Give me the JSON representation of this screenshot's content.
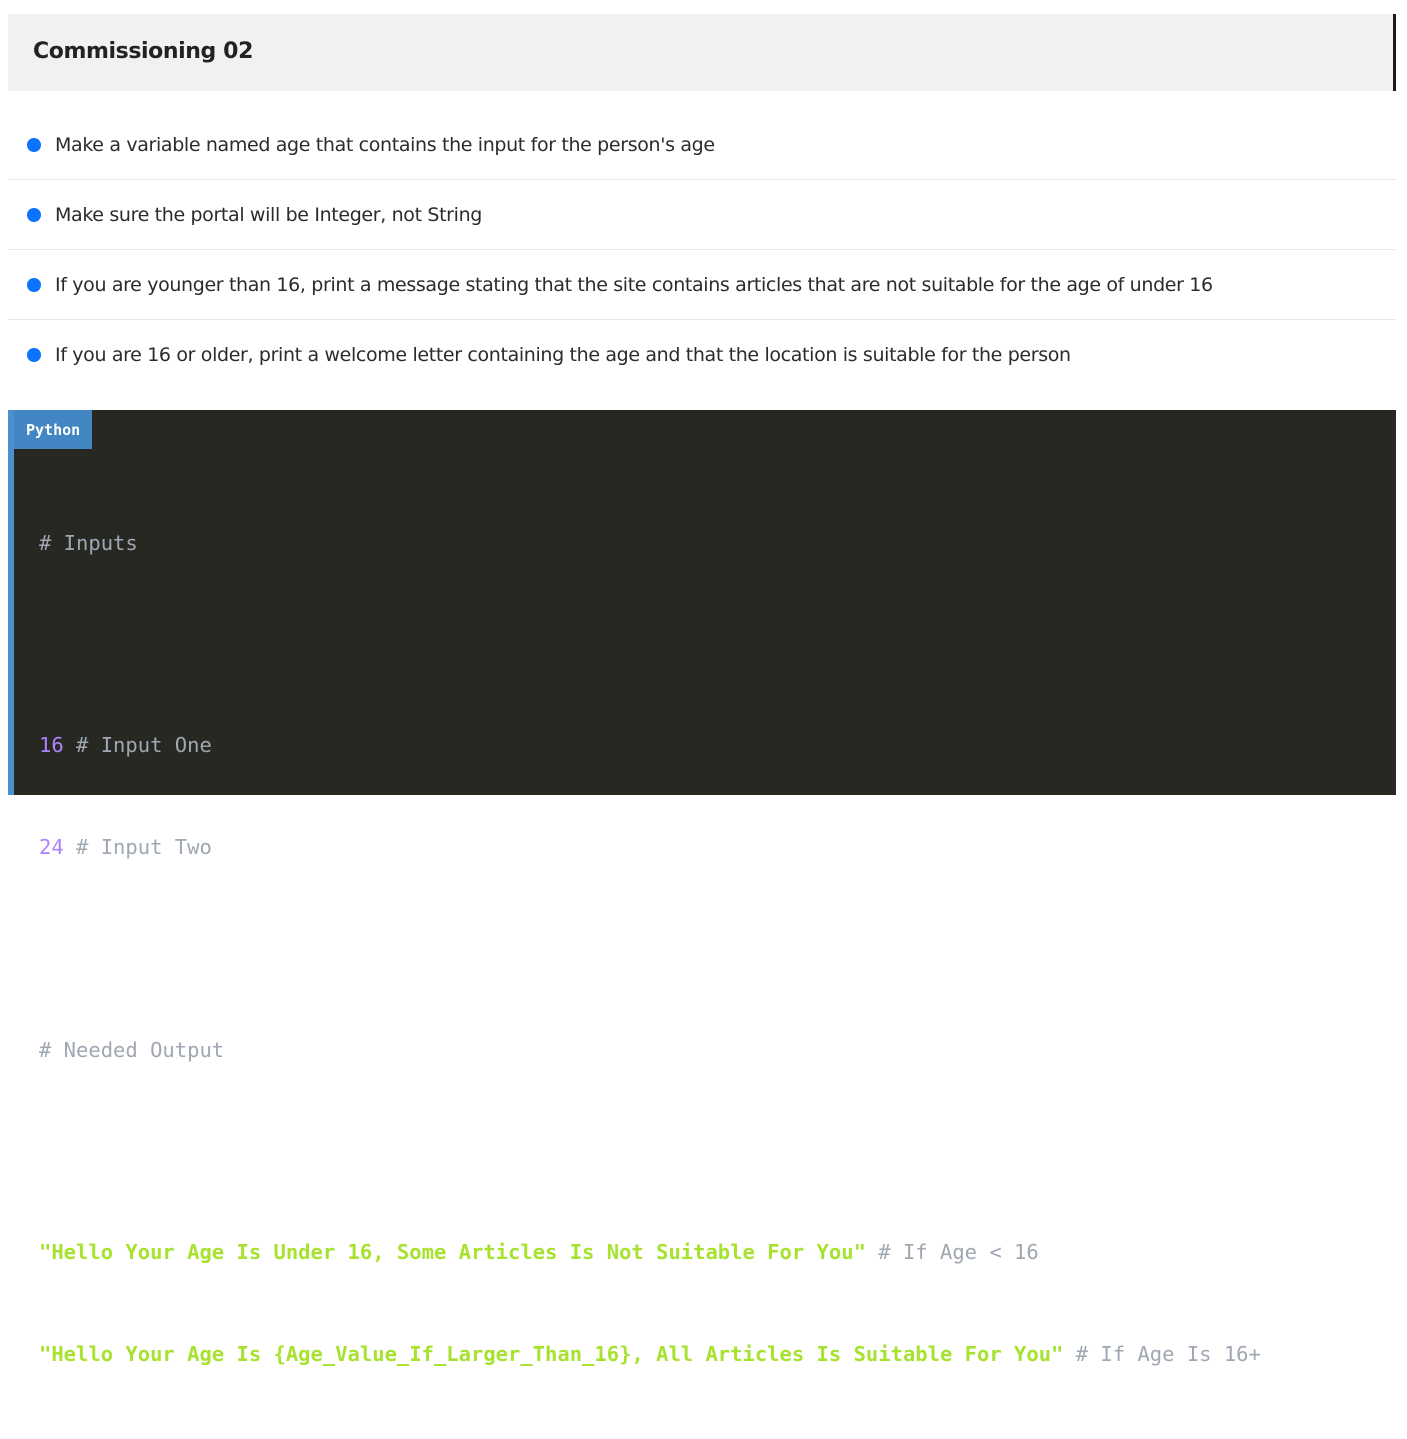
{
  "header": {
    "title": "Commissioning 02"
  },
  "tasks": [
    "Make a variable named age that contains the input for the person's age",
    "Make sure the portal will be Integer, not String",
    "If you are younger than 16, print a message stating that the site contains articles that are not suitable for the age of under 16",
    "If you are 16 or older, print a welcome letter containing the age and that the location is suitable for the person"
  ],
  "code_block": {
    "language": "Python",
    "lines": {
      "l1_comment": "# Inputs",
      "l3_num": "16",
      "l3_comment": "# Input One",
      "l4_num": "24",
      "l4_comment": "# Input Two",
      "l6_comment": "# Needed Output",
      "l8_string": "\"Hello Your Age Is Under 16, Some Articles Is Not Suitable For You\"",
      "l8_comment": "# If Age < 16",
      "l9_string": "\"Hello Your Age Is {Age_Value_If_Larger_Than_16}, All Articles Is Suitable For You\"",
      "l9_comment": "# If Age Is 16+"
    }
  },
  "colors": {
    "bullet": "#0b73ff",
    "code_background": "#272822",
    "language_tag": "#4286c4",
    "number": "#ae81ff",
    "string": "#a6e22e",
    "comment": "#9fa7b2"
  }
}
